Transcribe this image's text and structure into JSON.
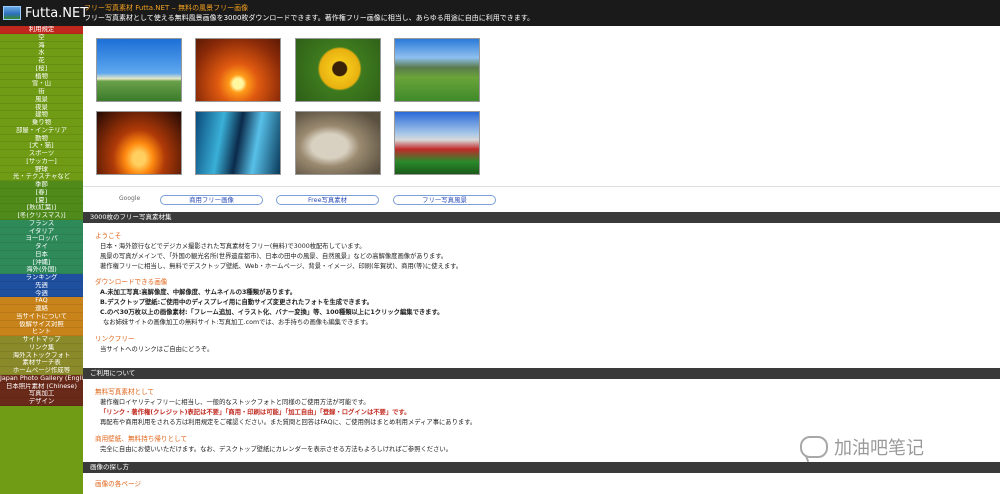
{
  "header": {
    "logo": "Futta.NET",
    "line1": "フリー写真素材 Futta.NET ‒ 無料の風景フリー画像",
    "line2": "フリー写真素材として使える無料風景画像を3000枚ダウンロードできます。著作権フリー画像に相当し、あらゆる用途に自由に利用できます。"
  },
  "sidebar": [
    {
      "label": "利用規定",
      "style": "grp-red"
    },
    {
      "label": "空",
      "style": "grp-green"
    },
    {
      "label": "海",
      "style": "grp-green"
    },
    {
      "label": "水",
      "style": "grp-green"
    },
    {
      "label": "花",
      "style": "grp-green"
    },
    {
      "label": "[桜]",
      "style": "grp-green"
    },
    {
      "label": "植物",
      "style": "grp-green"
    },
    {
      "label": "雪・山",
      "style": "grp-green"
    },
    {
      "label": "街",
      "style": "grp-green"
    },
    {
      "label": "風景",
      "style": "grp-green"
    },
    {
      "label": "夜景",
      "style": "grp-green"
    },
    {
      "label": "建物",
      "style": "grp-green"
    },
    {
      "label": "乗り物",
      "style": "grp-green"
    },
    {
      "label": "部屋・インテリア",
      "style": "grp-green"
    },
    {
      "label": "動物",
      "style": "grp-green"
    },
    {
      "label": "[犬・猫]",
      "style": "grp-green"
    },
    {
      "label": "スポーツ",
      "style": "grp-green"
    },
    {
      "label": "[サッカー]",
      "style": "grp-green"
    },
    {
      "label": "野球",
      "style": "grp-green"
    },
    {
      "label": "光・テクスチャなど",
      "style": "grp-green"
    },
    {
      "label": "季節",
      "style": "grp-green2"
    },
    {
      "label": "[春]",
      "style": "grp-green2"
    },
    {
      "label": "[夏]",
      "style": "grp-green2"
    },
    {
      "label": "[秋(紅葉)]",
      "style": "grp-green2"
    },
    {
      "label": "[冬(クリスマス)]",
      "style": "grp-green2"
    },
    {
      "label": "フランス",
      "style": "grp-teal"
    },
    {
      "label": "イタリア",
      "style": "grp-teal"
    },
    {
      "label": "ヨーロッパ",
      "style": "grp-teal"
    },
    {
      "label": "タイ",
      "style": "grp-teal"
    },
    {
      "label": "日本",
      "style": "grp-teal"
    },
    {
      "label": "[沖縄]",
      "style": "grp-teal"
    },
    {
      "label": "海外(外国)",
      "style": "grp-teal"
    },
    {
      "label": "ランキング",
      "style": "grp-blue"
    },
    {
      "label": "先週",
      "style": "grp-blue"
    },
    {
      "label": "今週",
      "style": "grp-blue"
    },
    {
      "label": "FAQ",
      "style": "grp-orange"
    },
    {
      "label": "連絡",
      "style": "grp-orange"
    },
    {
      "label": "当サイトについて",
      "style": "grp-orange"
    },
    {
      "label": "仮解サイズ対照",
      "style": "grp-orange"
    },
    {
      "label": "ヒント",
      "style": "grp-orange"
    },
    {
      "label": "サイトマップ",
      "style": "grp-olive"
    },
    {
      "label": "リンク集",
      "style": "grp-olive"
    },
    {
      "label": "海外ストックフォト",
      "style": "grp-olive"
    },
    {
      "label": "素材サーチ表",
      "style": "grp-olive"
    },
    {
      "label": "ホームページ作成等",
      "style": "grp-olive"
    },
    {
      "label": "Japan Photo Gallery (English)",
      "style": "grp-dark"
    },
    {
      "label": "日本照片素材 (Chinese)",
      "style": "grp-dark"
    },
    {
      "label": "写真加工",
      "style": "grp-dark"
    },
    {
      "label": "デザイン",
      "style": "grp-dark"
    }
  ],
  "search": {
    "google_label": "Google",
    "tabs": [
      "商用フリー画像",
      "Free写真素材",
      "フリー写真風景"
    ]
  },
  "section1": {
    "title": "3000枚のフリー写真素材集",
    "welcome_heading": "ようこそ",
    "welcome_lines": [
      "日本・海外旅行などでデジカメ撮影された写真素材をフリー(無料)で3000枚配布しています。",
      "風景の写真がメインで、「外国の観光名所(世界遺産都市)、日本の田中の風景、自然風景」などの高解像度画像があります。",
      "著作権フリーに相当し、無料でデスクトップ壁紙、Web・ホームページ、背景・イメージ、印刷(年賀状)、商用(等)に使えます。"
    ],
    "download_heading": "ダウンロードできる画像",
    "download_lines": [
      "A.未加工写真:高解像度、中解像度、サムネイルの3種類があります。",
      "B.デスクトップ壁紙:ご使用中のディスプレイ用に自動サイズ変更されたフォトを生成できます。",
      "C.のべ30万枚以上の画像素材:「フレーム追加、イラスト化、バナー変換」等、100種類以上に1クリック編集できます。",
      "なお姉妹サイトの画像加工の無料サイト:写真加工.comでは、お手持ちの画像も編集できます。"
    ],
    "linkfree_heading": "リンクフリー",
    "linkfree_line": "当サイトへのリンクはご自由にどうぞ。"
  },
  "section2": {
    "title": "ご利用について",
    "heading1": "無料写真素材として",
    "lines1": [
      "著作権ロイヤリティフリーに相当し、一般的なストックフォトと同様のご使用方法が可能です。",
      "「リンク・著作権(クレジット)表記は不要」「商用・印刷は可能」「加工自由」「登録・ログインは不要」です。",
      "再配布や商用利用をされる方は利用規定をご確認ください。また質問と回答はFAQに、ご使用例はまとめ利用メディア事にあります。"
    ],
    "heading2": "商用壁紙、無料持ち帰りとして",
    "lines2": [
      "完全に自由にお使いいただけます。なお、デスクトップ壁紙にカレンダーを表示させる方法もよろしければご参照ください。"
    ]
  },
  "section3": {
    "title": "画像の探し方",
    "heading": "画像の各ページ"
  },
  "watermark": {
    "text": "加油吧笔记"
  }
}
